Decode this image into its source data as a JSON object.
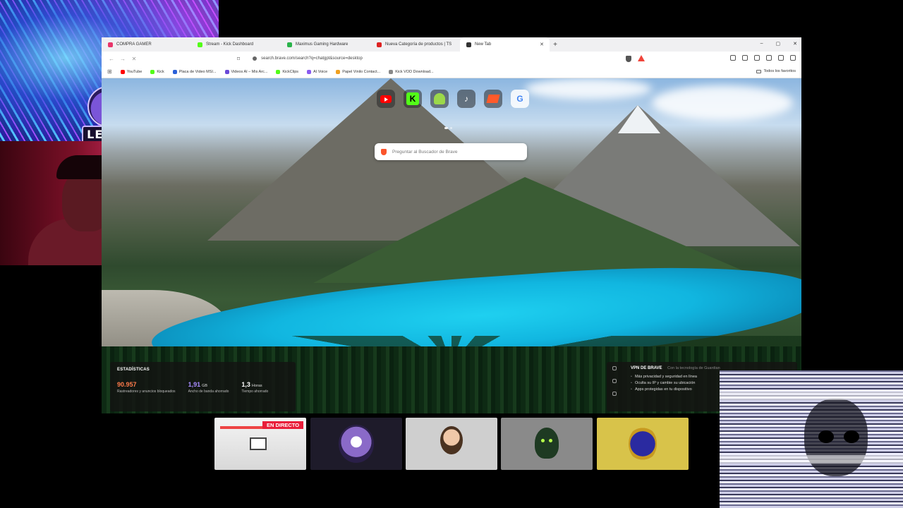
{
  "stream_logo": {
    "text": "LEVEL"
  },
  "browser": {
    "tabs": [
      {
        "label": "COMPRA GAMER",
        "color": "#e8356a",
        "active": false
      },
      {
        "label": "Stream - Kick Dashboard",
        "color": "#53fc18",
        "active": false
      },
      {
        "label": "Maximus Gaming Hardware",
        "color": "#2ab34a",
        "active": false
      },
      {
        "label": "Nueva Categoría de productos | TS",
        "color": "#d22",
        "active": false
      },
      {
        "label": "New Tab",
        "color": "#333",
        "active": true
      }
    ],
    "new_tab_symbol": "+",
    "address": "search.brave.com/search?q=chatgpt&source=desktop",
    "bookmarks": [
      {
        "label": "YouTube",
        "color": "#ff0000"
      },
      {
        "label": "Kick",
        "color": "#53fc18"
      },
      {
        "label": "Placa de Video MSI...",
        "color": "#2a60d8"
      },
      {
        "label": "Videos AI – Mis Arc...",
        "color": "#6a4ad8"
      },
      {
        "label": "KickClips",
        "color": "#53fc18"
      },
      {
        "label": "AI Voice",
        "color": "#8a5af0"
      },
      {
        "label": "Papel Vinilo Contact...",
        "color": "#f0a020"
      },
      {
        "label": "Kick VOD Download...",
        "color": "#888888"
      }
    ],
    "all_favorites": "Todos los favoritos"
  },
  "newtab": {
    "search_placeholder": "Preguntar al Buscador de Brave",
    "quick_links": [
      {
        "icon": "youtube-icon",
        "glyph": ""
      },
      {
        "icon": "kick-icon",
        "glyph": "K"
      },
      {
        "icon": "android-icon",
        "glyph": ""
      },
      {
        "icon": "tiktok-icon",
        "glyph": "♪"
      },
      {
        "icon": "brave-icon",
        "glyph": ""
      },
      {
        "icon": "google-icon",
        "glyph": "G"
      }
    ],
    "stats": {
      "title": "ESTADÍSTICAS",
      "items": [
        {
          "value": "90.957",
          "unit": "",
          "label": "Rastreadores y anuncios bloqueados",
          "color": "#ff7a4a"
        },
        {
          "value": "1,91",
          "unit": "GB",
          "label": "Ancho de banda ahorrado",
          "color": "#a88cff"
        },
        {
          "value": "1,3",
          "unit": "Horas",
          "label": "Tiempo ahorrado",
          "color": "#ffffff"
        }
      ]
    },
    "vpn": {
      "title": "VPN DE BRAVE",
      "subtitle": "Con la tecnología de Guardian",
      "features": [
        "Más privacidad y seguridad en línea",
        "Oculta su IP y cambie su ubicación",
        "Apps protegidas en tu dispositivo"
      ]
    }
  },
  "thumbnails": {
    "live_badge": "EN DIRECTO"
  }
}
